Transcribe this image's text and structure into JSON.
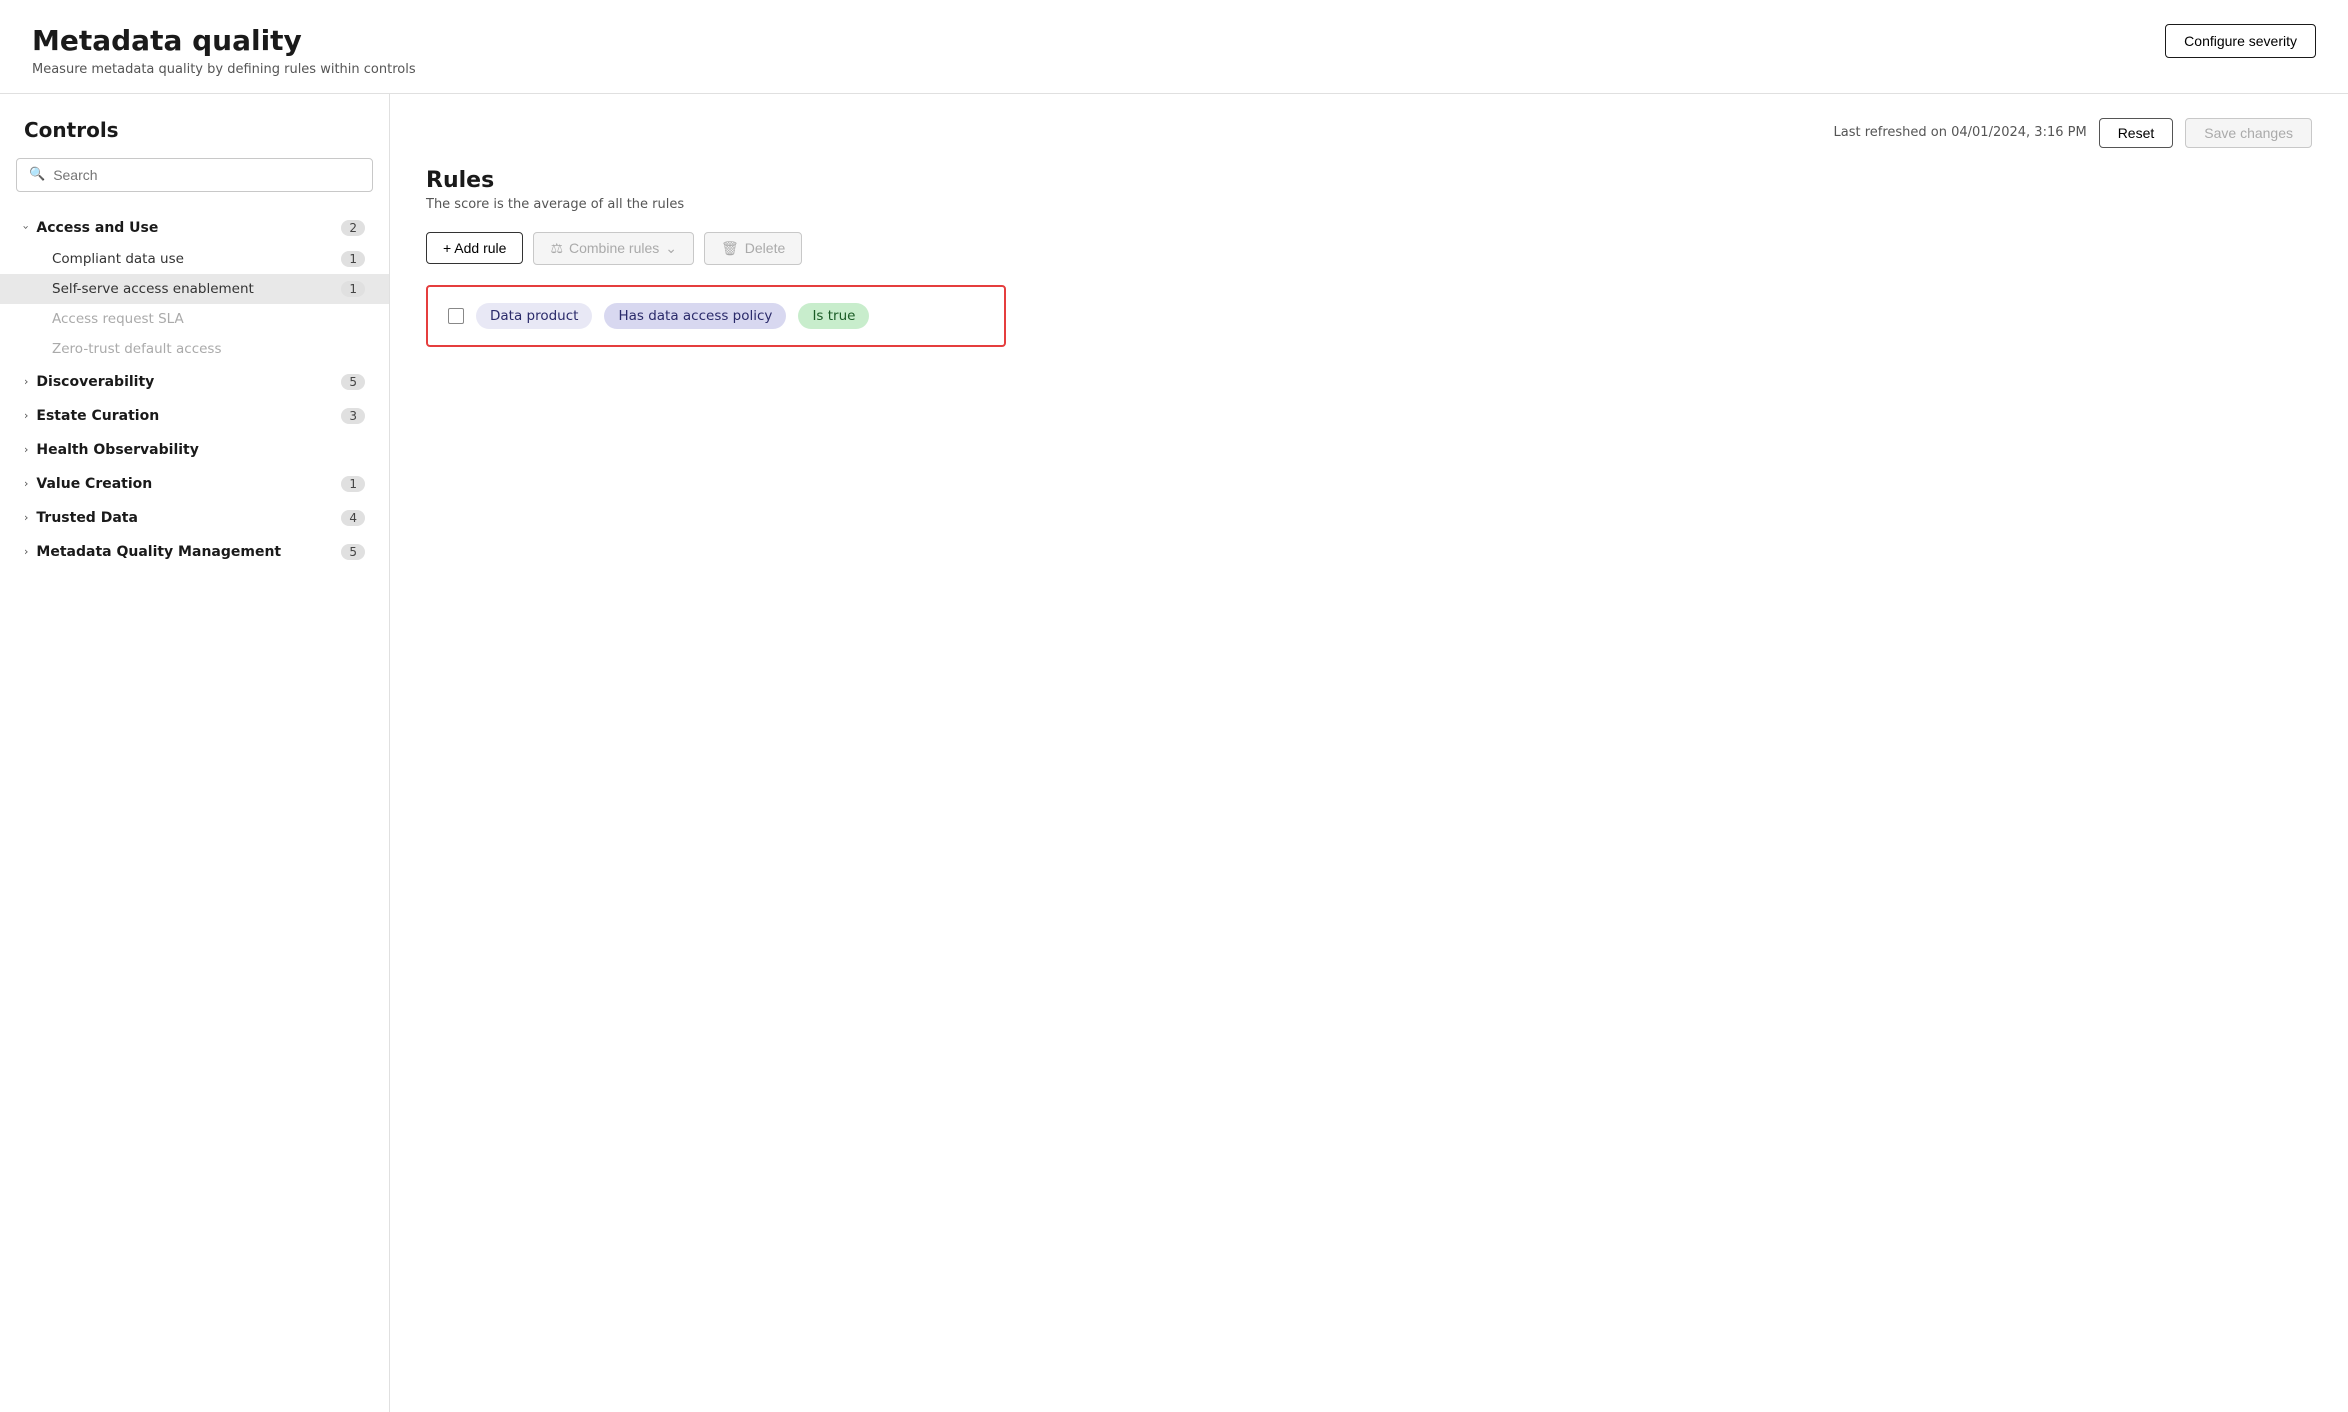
{
  "header": {
    "title": "Metadata quality",
    "subtitle": "Measure metadata quality by defining rules within controls",
    "configure_severity_label": "Configure severity"
  },
  "sidebar": {
    "heading": "Controls",
    "search_placeholder": "Search",
    "groups": [
      {
        "id": "access-and-use",
        "label": "Access and Use",
        "badge": "2",
        "expanded": true,
        "children": [
          {
            "id": "compliant-data-use",
            "label": "Compliant data use",
            "badge": "1",
            "active": false,
            "disabled": false
          },
          {
            "id": "self-serve-access",
            "label": "Self-serve access enablement",
            "badge": "1",
            "active": true,
            "disabled": false
          },
          {
            "id": "access-request-sla",
            "label": "Access request SLA",
            "badge": "",
            "active": false,
            "disabled": true
          },
          {
            "id": "zero-trust",
            "label": "Zero-trust default access",
            "badge": "",
            "active": false,
            "disabled": true
          }
        ]
      },
      {
        "id": "discoverability",
        "label": "Discoverability",
        "badge": "5",
        "expanded": false,
        "children": []
      },
      {
        "id": "estate-curation",
        "label": "Estate Curation",
        "badge": "3",
        "expanded": false,
        "children": []
      },
      {
        "id": "health-observability",
        "label": "Health Observability",
        "badge": "",
        "expanded": false,
        "children": []
      },
      {
        "id": "value-creation",
        "label": "Value Creation",
        "badge": "1",
        "expanded": false,
        "children": []
      },
      {
        "id": "trusted-data",
        "label": "Trusted Data",
        "badge": "4",
        "expanded": false,
        "children": []
      },
      {
        "id": "metadata-quality-management",
        "label": "Metadata Quality Management",
        "badge": "5",
        "expanded": false,
        "children": []
      }
    ]
  },
  "right_panel": {
    "last_refreshed": "Last refreshed on 04/01/2024, 3:16 PM",
    "reset_label": "Reset",
    "save_changes_label": "Save changes",
    "rules_title": "Rules",
    "rules_subtitle": "The score is the average of all the rules",
    "add_rule_label": "+ Add rule",
    "combine_rules_label": "Combine rules",
    "delete_label": "Delete",
    "rule": {
      "chip1": "Data product",
      "chip2": "Has data access policy",
      "chip3": "Is true"
    }
  }
}
